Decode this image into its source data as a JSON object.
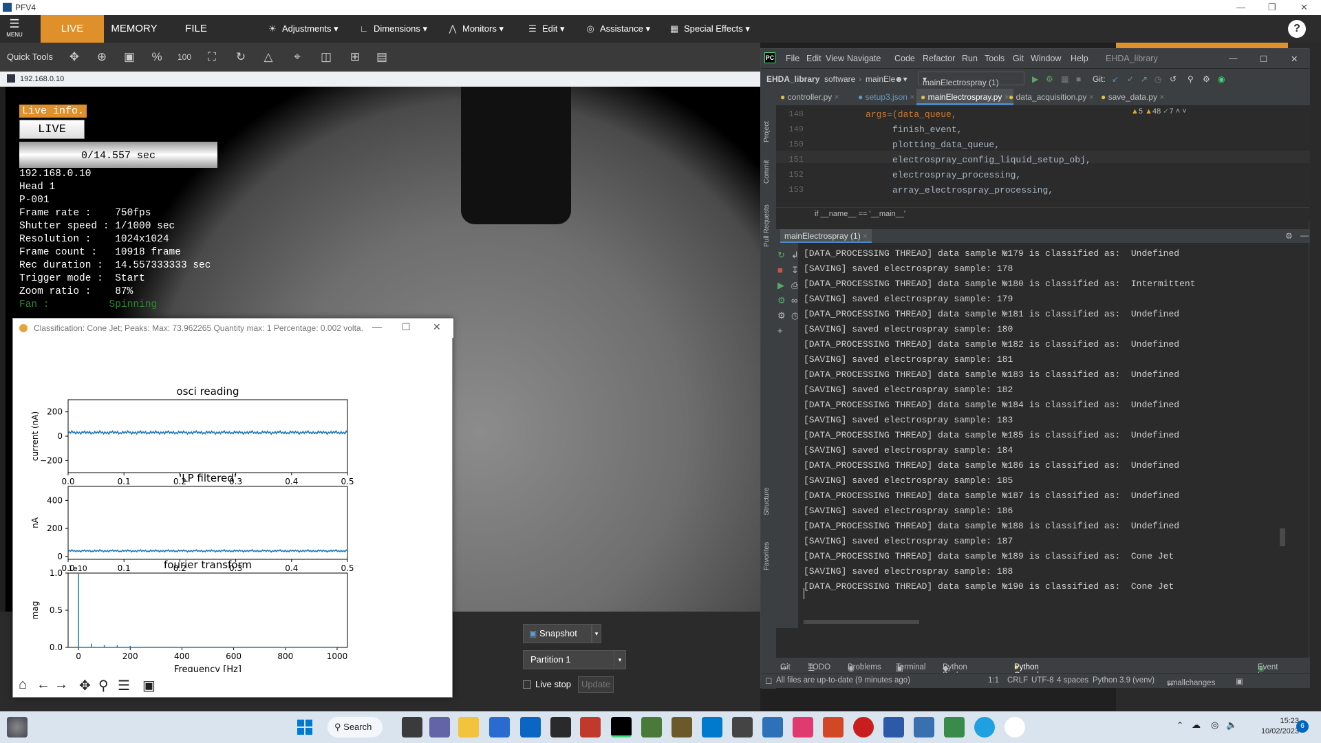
{
  "pfv": {
    "window_title": "PFV4",
    "menu_label": "MENU",
    "tabs": [
      "LIVE",
      "MEMORY",
      "FILE"
    ],
    "menus": [
      "Adjustments",
      "Dimensions",
      "Monitors",
      "Edit",
      "Assistance",
      "Special Effects"
    ],
    "quick_tools_label": "Quick Tools",
    "quick_tools": [
      "move-icon",
      "zoom-in-icon",
      "zoom-region-icon",
      "percent-icon",
      "100-icon",
      "fit-icon",
      "rotate-icon",
      "flip-icon",
      "crosshair-icon",
      "lock-icon",
      "grid-icon",
      "layout-icon"
    ],
    "video_source": "192.168.0.10",
    "help": "?",
    "overlay": {
      "live_info": "Live info.",
      "live_button": "LIVE",
      "progress": "0/14.557 sec",
      "rows": [
        "192.168.0.10",
        "Head 1",
        "P-001",
        "Frame rate :    750fps",
        "Shutter speed : 1/1000 sec",
        "Resolution :    1024x1024",
        "Frame count :   10918 frame",
        "Rec duration :  14.557333333 sec",
        "Trigger mode :  Start",
        "Zoom ratio :    87%"
      ],
      "fan_label": "Fan :",
      "fan_value": "Spinning"
    },
    "controls": {
      "snapshot": "Snapshot",
      "partition": "Partition 1",
      "live_stop": "Live stop",
      "update": "Update"
    }
  },
  "figure": {
    "title": "Classification: Cone Jet; Peaks: Max: 73.962265 Quantity max: 1 Percentage: 0.002 volta...",
    "subplots": [
      {
        "title": "osci reading",
        "ylabel": "current (nA)",
        "yticks": [
          "200",
          "0",
          "−200"
        ],
        "xticks": [
          "0.0",
          "0.1",
          "0.2",
          "0.3",
          "0.4",
          "0.5"
        ]
      },
      {
        "title": "'LP filtered'",
        "ylabel": "nA",
        "yticks": [
          "400",
          "200",
          "0"
        ],
        "xticks": [
          "0.0",
          "0.1",
          "0.2",
          "0.3",
          "0.4",
          "0.5"
        ]
      },
      {
        "title": "fourier transform",
        "ylabel": "mag",
        "yticks": [
          "1.0",
          "0.5",
          "0.0"
        ],
        "xticks": [
          "0",
          "200",
          "400",
          "600",
          "800",
          "1000"
        ],
        "xlabel": "Frequency [Hz]",
        "offset": "1e10"
      }
    ],
    "toolbar": [
      "home-icon",
      "back-icon",
      "forward-icon",
      "pan-icon",
      "zoom-icon",
      "configure-icon",
      "save-icon"
    ]
  },
  "chart_data": [
    {
      "type": "line",
      "title": "osci reading",
      "xlabel": "",
      "ylabel": "current (nA)",
      "xlim": [
        0.0,
        0.5
      ],
      "ylim": [
        -300,
        300
      ],
      "series": [
        {
          "x": [
            0.0,
            0.5
          ],
          "values": [
            30,
            30
          ]
        }
      ]
    },
    {
      "type": "line",
      "title": "'LP filtered'",
      "xlabel": "",
      "ylabel": "nA",
      "xlim": [
        0.0,
        0.5
      ],
      "ylim": [
        -20,
        500
      ],
      "series": [
        {
          "x": [
            0.0,
            0.5
          ],
          "values": [
            40,
            40
          ]
        }
      ]
    },
    {
      "type": "line",
      "title": "fourier transform",
      "xlabel": "Frequency [Hz]",
      "ylabel": "mag",
      "xlim": [
        -40,
        1040
      ],
      "ylim": [
        0,
        1.0
      ],
      "series": [
        {
          "x": [
            0,
            50,
            100,
            150,
            200,
            1000
          ],
          "values": [
            1.0,
            0.05,
            0.03,
            0.03,
            0.02,
            0.0
          ]
        }
      ]
    }
  ],
  "pycharm": {
    "menu": [
      "File",
      "Edit",
      "View",
      "Navigate",
      "Code",
      "Refactor",
      "Run",
      "Tools",
      "Git",
      "Window",
      "Help"
    ],
    "project_name": "EHDA_library",
    "nav": [
      "EHDA_library",
      "software",
      "mainEle"
    ],
    "run_config": "mainElectrospray (1)",
    "git_label": "Git:",
    "tabs": [
      "controller.py",
      "setup3.json",
      "mainElectrospray.py",
      "data_acquisition.py",
      "save_data.py"
    ],
    "active_tab": 2,
    "inspections": {
      "warnings": "5",
      "weak": "48",
      "ok": "7"
    },
    "code_lines": [
      {
        "n": "148",
        "text": "args=(data_queue,"
      },
      {
        "n": "149",
        "text": "     finish_event,"
      },
      {
        "n": "150",
        "text": "     plotting_data_queue,"
      },
      {
        "n": "151",
        "text": "     electrospray_config_liquid_setup_obj,"
      },
      {
        "n": "152",
        "text": "     electrospray_processing,"
      },
      {
        "n": "153",
        "text": "     array_electrospray_processing,"
      }
    ],
    "breadcrumb": "if __name__ == '__main__'",
    "run_tab": "mainElectrospray (1)",
    "console": [
      "[DATA_PROCESSING THREAD] data sample №179 is classified as:  Undefined",
      "[SAVING] saved electrospray sample: 178",
      "[DATA_PROCESSING THREAD] data sample №180 is classified as:  Intermittent",
      "[SAVING] saved electrospray sample: 179",
      "[DATA_PROCESSING THREAD] data sample №181 is classified as:  Undefined",
      "[SAVING] saved electrospray sample: 180",
      "[DATA_PROCESSING THREAD] data sample №182 is classified as:  Undefined",
      "[SAVING] saved electrospray sample: 181",
      "[DATA_PROCESSING THREAD] data sample №183 is classified as:  Undefined",
      "[SAVING] saved electrospray sample: 182",
      "[DATA_PROCESSING THREAD] data sample №184 is classified as:  Undefined",
      "[SAVING] saved electrospray sample: 183",
      "[DATA_PROCESSING THREAD] data sample №185 is classified as:  Undefined",
      "[SAVING] saved electrospray sample: 184",
      "[DATA_PROCESSING THREAD] data sample №186 is classified as:  Undefined",
      "[SAVING] saved electrospray sample: 185",
      "[DATA_PROCESSING THREAD] data sample №187 is classified as:  Undefined",
      "[SAVING] saved electrospray sample: 186",
      "[DATA_PROCESSING THREAD] data sample №188 is classified as:  Undefined",
      "[SAVING] saved electrospray sample: 187",
      "[DATA_PROCESSING THREAD] data sample №189 is classified as:  Cone Jet",
      "[SAVING] saved electrospray sample: 188",
      "[DATA_PROCESSING THREAD] data sample №190 is classified as:  Cone Jet"
    ],
    "side_labels": [
      "Project",
      "Commit",
      "Pull Requests",
      "Structure",
      "Favorites"
    ],
    "bottom_tabs": [
      "Git",
      "TODO",
      "Problems",
      "Terminal",
      "Python Packages",
      "Python Console"
    ],
    "event_log": "Event Log",
    "status": {
      "message": "All files are up-to-date (9 minutes ago)",
      "pos": "1:1",
      "eol": "CRLF",
      "enc": "UTF-8",
      "indent": "4 spaces",
      "interp": "Python 3.9 (venv)",
      "branch": "smallchanges"
    }
  },
  "taskbar": {
    "search": "Search",
    "time": "15:23",
    "date": "10/02/2023",
    "badge": "6"
  }
}
